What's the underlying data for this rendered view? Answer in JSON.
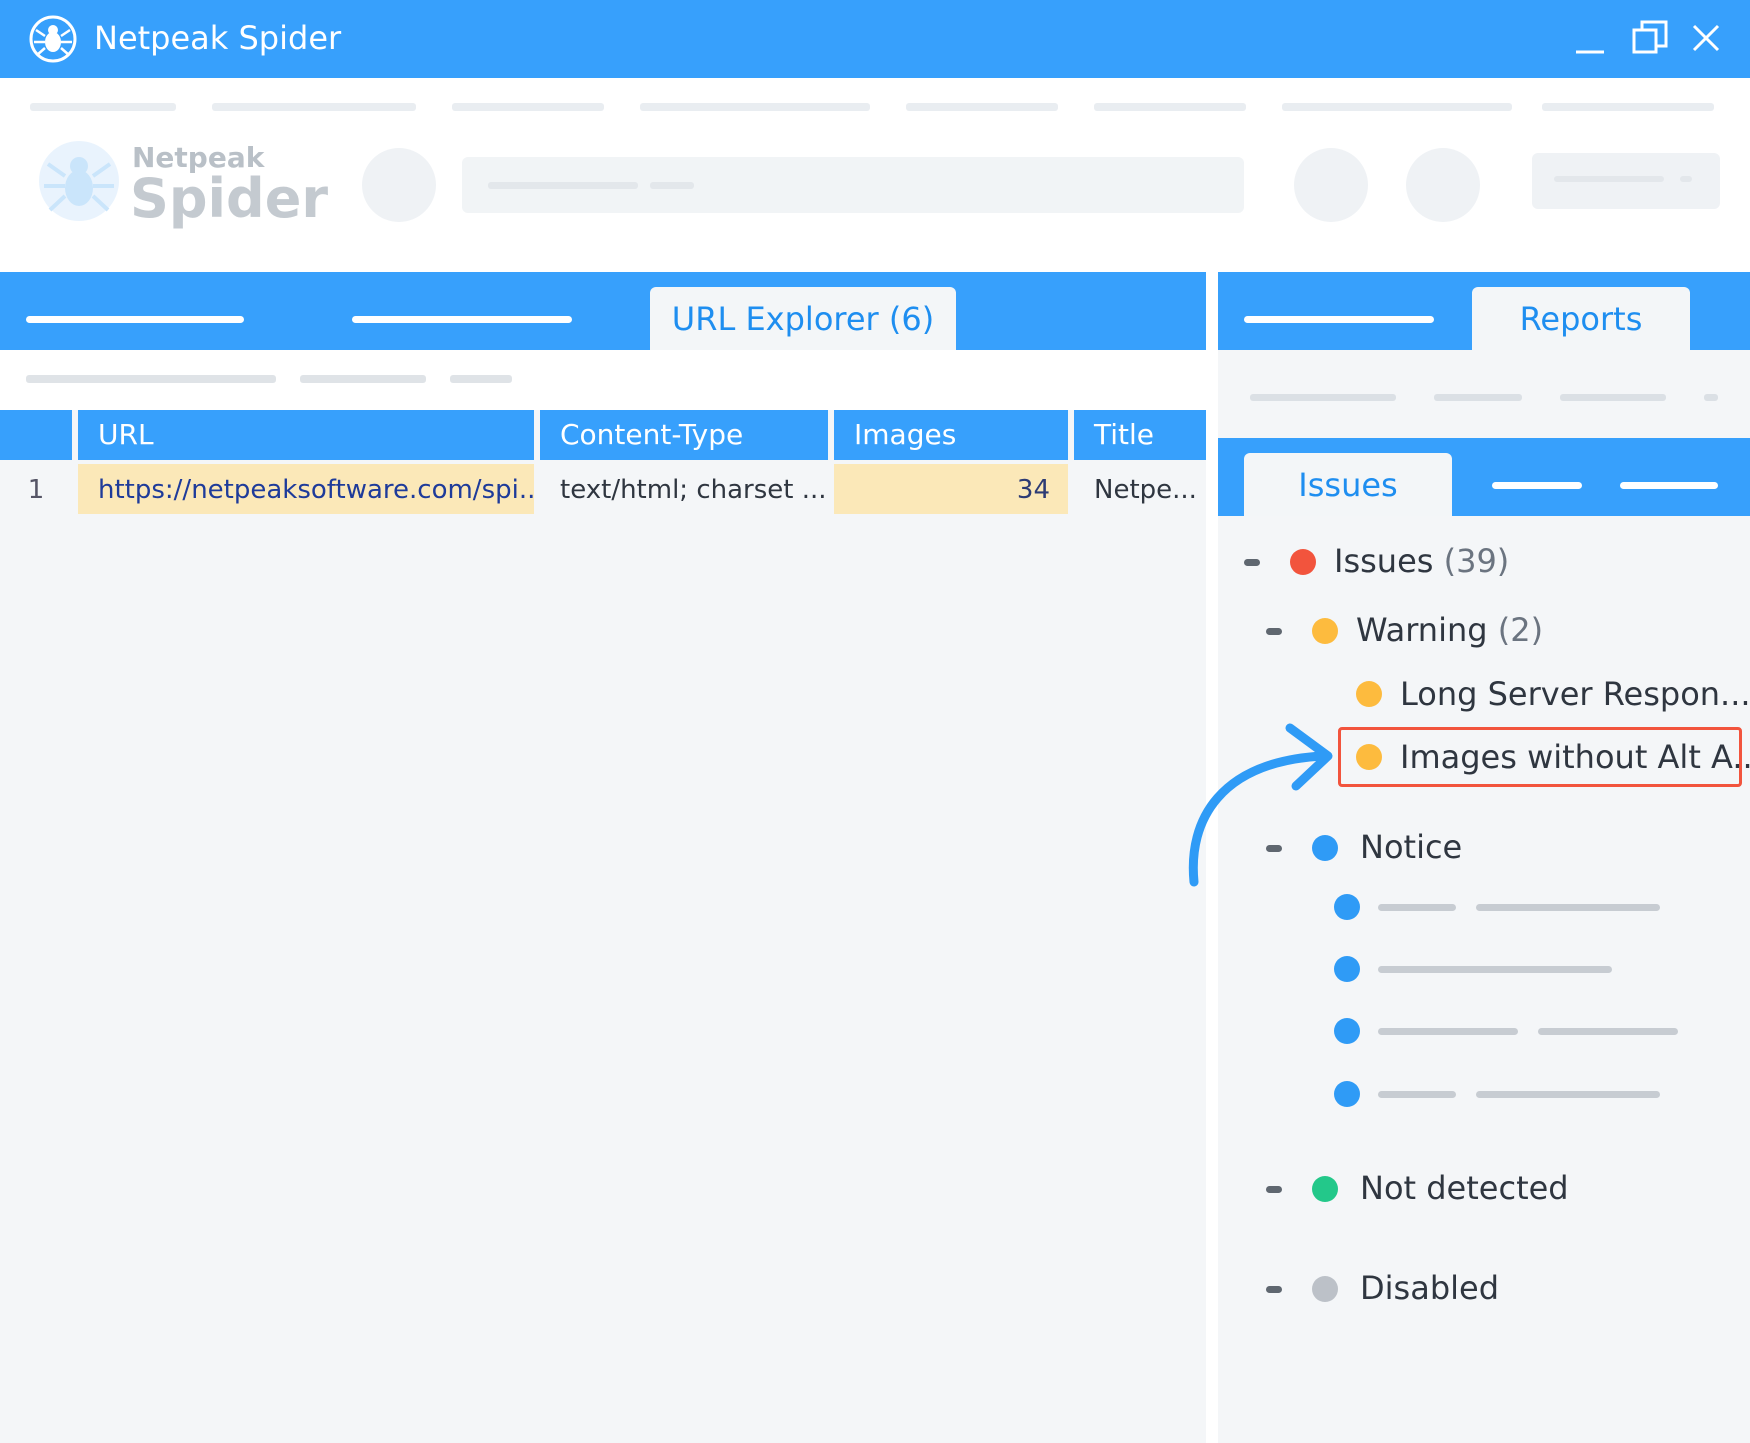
{
  "app": {
    "title": "Netpeak Spider",
    "brand_small": "Netpeak",
    "brand_big": "Spider"
  },
  "left_tabs": {
    "active_label": "URL Explorer (6)"
  },
  "table": {
    "columns": [
      "URL",
      "Content-Type",
      "Images",
      "Title"
    ],
    "rows": [
      {
        "num": "1",
        "url": "https://netpeaksoftware.com/spi...",
        "content_type": "text/html; charset ...",
        "images": "34",
        "title": "Netpe..."
      }
    ]
  },
  "right_tabs": {
    "active_label": "Reports"
  },
  "report_tabs": {
    "active_label": "Issues"
  },
  "tree": {
    "issues": {
      "label": "Issues",
      "count": "(39)",
      "color": "#f2543d"
    },
    "warning": {
      "label": "Warning",
      "count": "(2)",
      "color": "#fdbb3e"
    },
    "warning_items": [
      {
        "label": "Long Server Respon...",
        "color": "#fdbb3e"
      },
      {
        "label": "Images without Alt A...",
        "color": "#fdbb3e",
        "highlighted": true
      }
    ],
    "notice": {
      "label": "Notice",
      "color": "#2f9bf6"
    },
    "not_detected": {
      "label": "Not detected",
      "color": "#23c88a"
    },
    "disabled": {
      "label": "Disabled",
      "color": "#bcc1c8"
    }
  },
  "colors": {
    "accent": "#37a0fc",
    "highlight_border": "#f2543d",
    "selected_cell": "#fbe8b8"
  }
}
